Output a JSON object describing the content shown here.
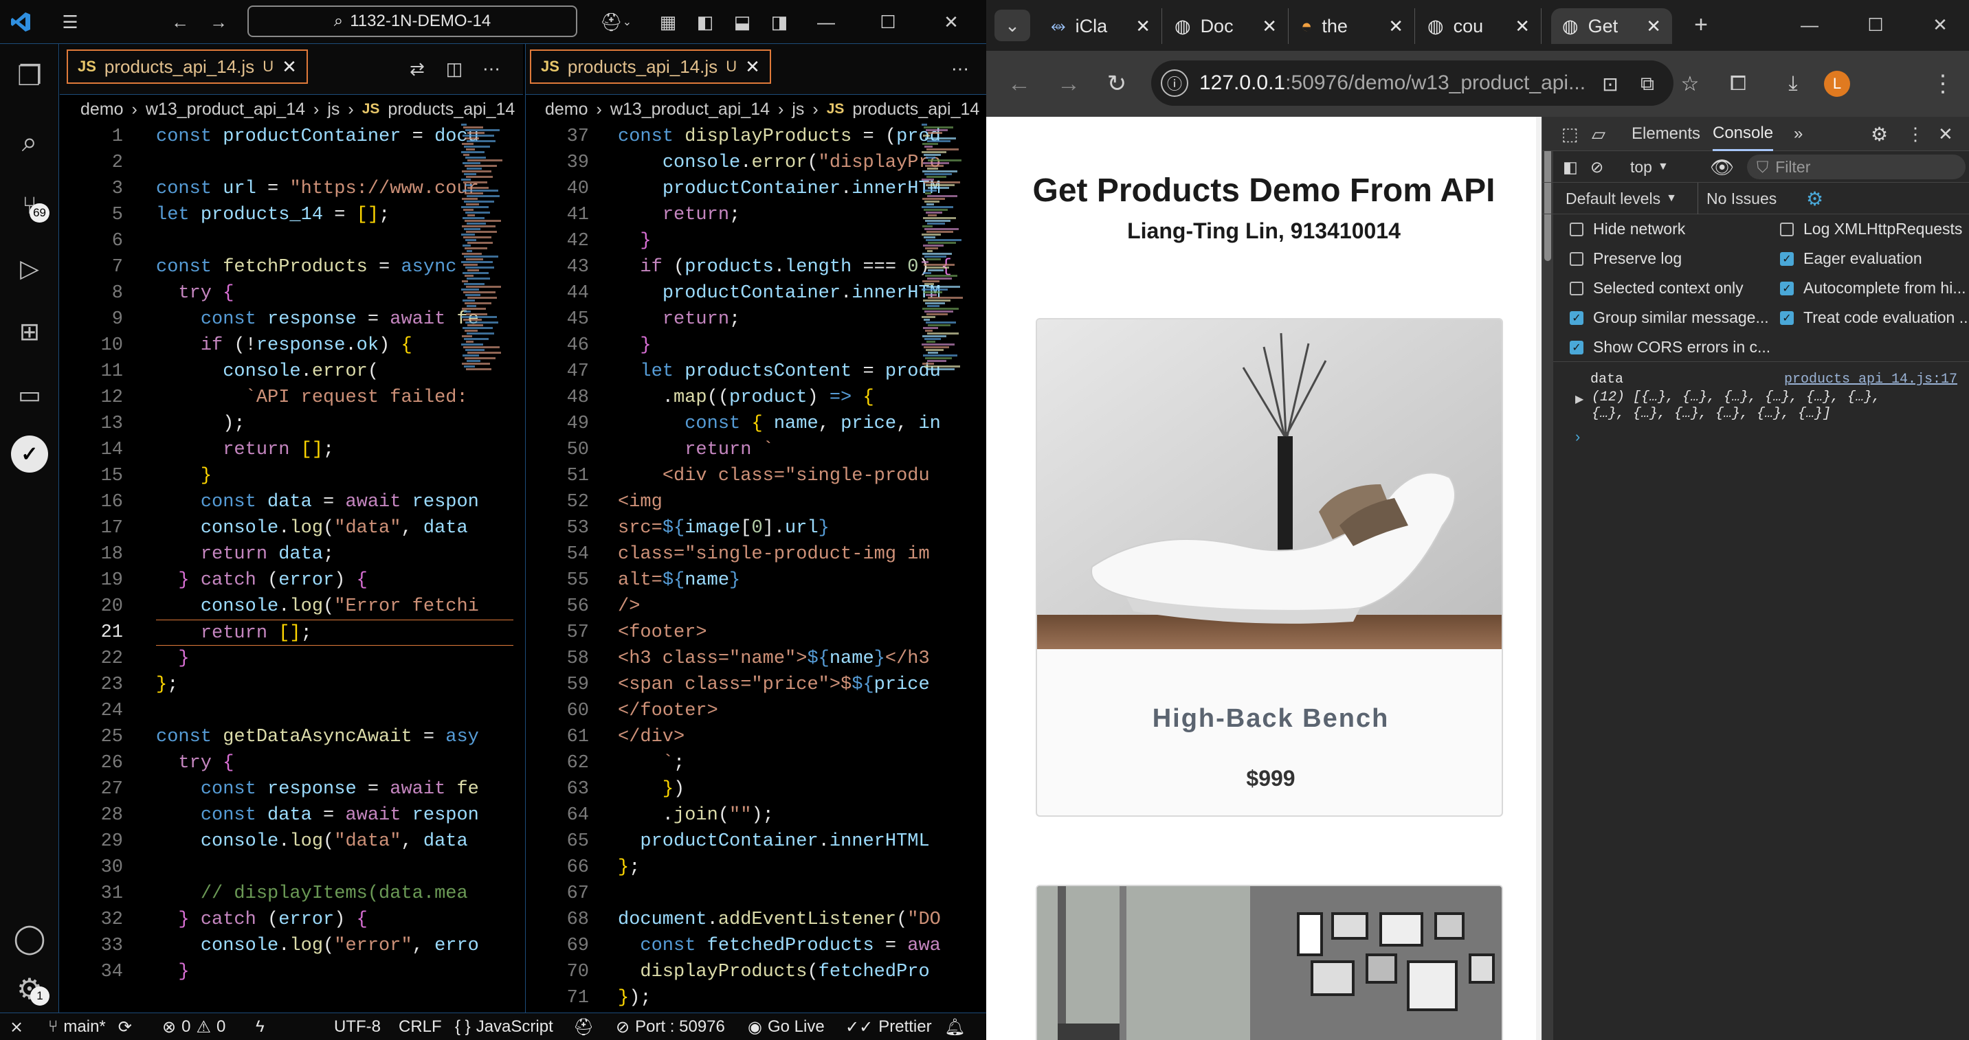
{
  "vscode": {
    "title_search": "1132-1N-DEMO-14",
    "activity_badges": {
      "source_control": "69",
      "accounts_settings": "1"
    },
    "left_editor": {
      "tab_label": "products_api_14.js",
      "tab_status": "U",
      "breadcrumb": [
        "demo",
        "w13_product_api_14",
        "js",
        "products_api_14"
      ],
      "current_line": 21
    },
    "right_editor": {
      "tab_label": "products_api_14.js",
      "tab_status": "U",
      "breadcrumb": [
        "demo",
        "w13_product_api_14",
        "js",
        "products_api_14"
      ]
    },
    "status": {
      "branch": "main*",
      "errors": "0",
      "warnings": "0",
      "encoding": "UTF-8",
      "eol": "CRLF",
      "language": "JavaScript",
      "port": "Port : 50976",
      "go_live": "Go Live",
      "prettier": "Prettier"
    }
  },
  "browser": {
    "tabs": [
      {
        "label": "iCla",
        "icon": "tab-icon-iclass"
      },
      {
        "label": "Doc",
        "icon": "globe-icon"
      },
      {
        "label": "the",
        "icon": "tab-icon-food"
      },
      {
        "label": "cou",
        "icon": "globe-icon"
      },
      {
        "label": "Get",
        "icon": "globe-icon",
        "active": true
      }
    ],
    "url_host": "127.0.0.1",
    "url_rest": ":50976/demo/w13_product_api...",
    "profile_initial": "L",
    "page": {
      "title": "Get Products Demo From API",
      "subtitle": "Liang-Ting Lin, 913410014",
      "products": [
        {
          "name": "High-Back Bench",
          "price": "$999"
        }
      ]
    },
    "devtools": {
      "tabs": [
        "Elements",
        "Console"
      ],
      "active_tab": "Console",
      "context": "top",
      "filter_placeholder": "Filter",
      "levels": "Default levels",
      "issues": "No Issues",
      "options_left": [
        {
          "label": "Hide network",
          "checked": false
        },
        {
          "label": "Preserve log",
          "checked": false
        },
        {
          "label": "Selected context only",
          "checked": false
        },
        {
          "label": "Group similar message...",
          "checked": true
        },
        {
          "label": "Show CORS errors in c...",
          "checked": true
        }
      ],
      "options_right": [
        {
          "label": "Log XMLHttpRequests",
          "checked": false
        },
        {
          "label": "Eager evaluation",
          "checked": true
        },
        {
          "label": "Autocomplete from hi...",
          "checked": true
        },
        {
          "label": "Treat code evaluation ...",
          "checked": true
        }
      ],
      "console": {
        "label": "data",
        "source": "products_api_14.js:17",
        "value_line1": "(12) [{…}, {…}, {…}, {…}, {…}, {…},",
        "value_line2": "{…}, {…}, {…}, {…}, {…}, {…}]"
      }
    }
  },
  "colors": {
    "accent_border": "#1d4c7a",
    "tab_border": "#e07a3a",
    "checkbox_on": "#4aa8d8"
  }
}
